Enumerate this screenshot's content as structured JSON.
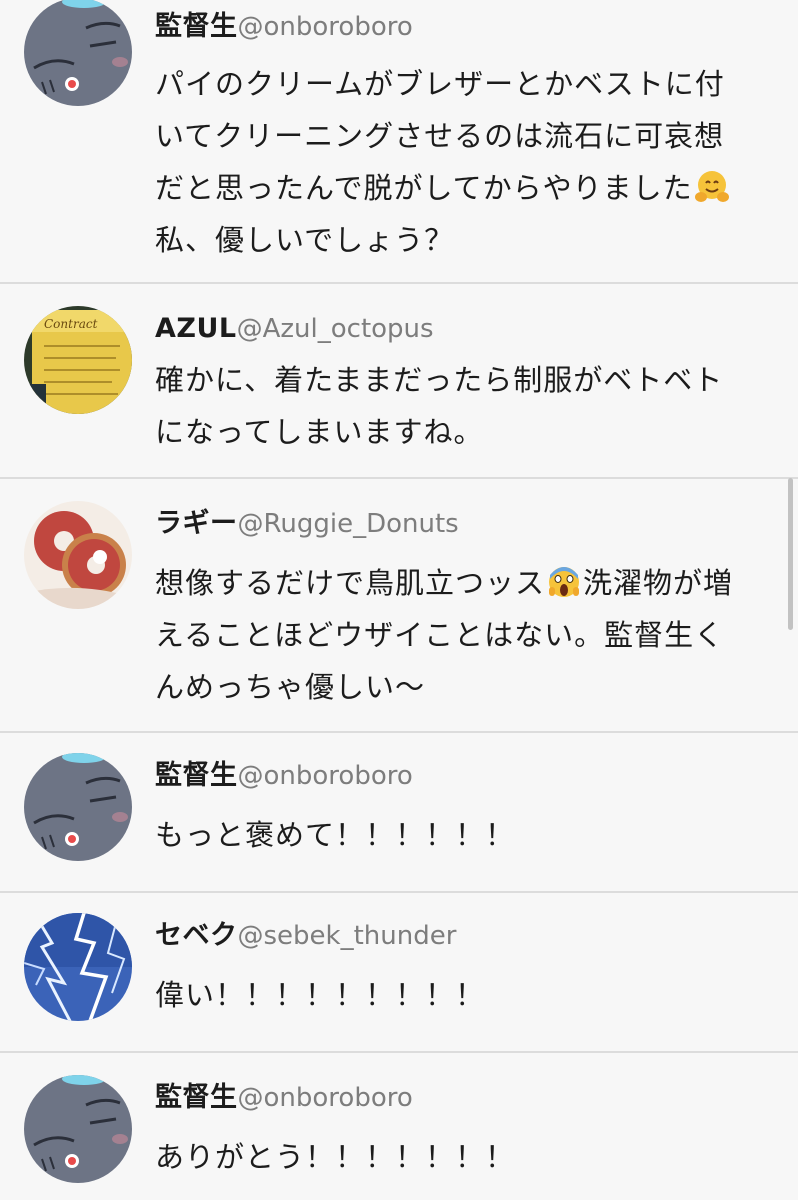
{
  "posts": [
    {
      "name": "監督生",
      "handle": "@onboroboro",
      "avatar": "ghost-cat-avatar",
      "lines": [
        "パイのクリームがブレザーとかベストに付",
        "いてクリーニングさせるのは流石に可哀想",
        "だと思ったんで脱がしてからやりました",
        "私、優しいでしょう？"
      ],
      "emoji": "hugging-face-emoji"
    },
    {
      "name": "AZUL",
      "handle": "@Azul_octopus",
      "avatar": "contract-scroll-avatar",
      "lines": [
        "確かに、着たままだったら制服がベトベト",
        "になってしまいますね。"
      ]
    },
    {
      "name": "ラギー",
      "handle": "@Ruggie_Donuts",
      "avatar": "donuts-avatar",
      "line1_before": "想像するだけで鳥肌立つッス",
      "line1_after": "洗濯物が増",
      "lines": [
        "えることほどウザイことはない。監督生く",
        "んめっちゃ優しい〜"
      ],
      "emoji": "screaming-face-emoji"
    },
    {
      "name": "監督生",
      "handle": "@onboroboro",
      "avatar": "ghost-cat-avatar",
      "lines": [
        "もっと褒めて！！！！！！"
      ]
    },
    {
      "name": "セベク",
      "handle": "@sebek_thunder",
      "avatar": "lightning-avatar",
      "lines": [
        "偉い！！！！！！！！！"
      ]
    },
    {
      "name": "監督生",
      "handle": "@onboroboro",
      "avatar": "ghost-cat-avatar",
      "lines": [
        "ありがとう！！！！！！！"
      ]
    }
  ],
  "colors": {
    "background": "#f7f7f7",
    "divider": "#dcdcdc",
    "handle": "#7d7d7d",
    "text": "#1c1c1c"
  }
}
